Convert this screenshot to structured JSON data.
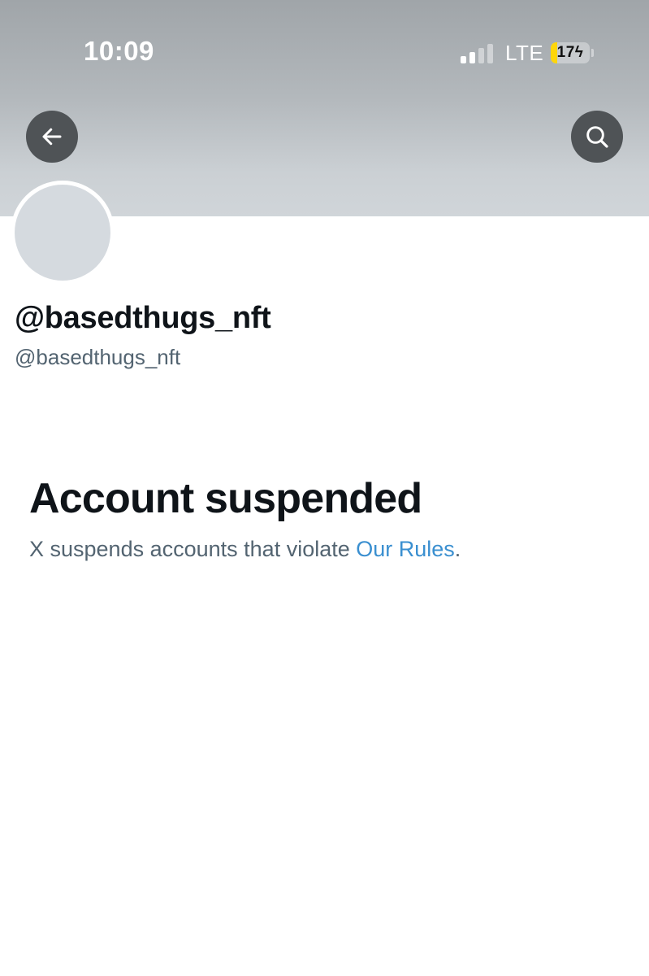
{
  "status_bar": {
    "time": "10:09",
    "network": "LTE",
    "battery_level": "17",
    "battery_fraction": 0.17,
    "signal_bars_active": 2,
    "signal_bars_total": 4
  },
  "header": {
    "back_icon": "arrow-left-icon",
    "search_icon": "search-icon"
  },
  "profile": {
    "display_name": "@basedthugs_nft",
    "handle": "@basedthugs_nft"
  },
  "notice": {
    "title": "Account suspended",
    "description_prefix": "X suspends accounts that violate ",
    "link_text": "Our Rules",
    "description_suffix": "."
  },
  "colors": {
    "text_primary": "#0f1419",
    "text_secondary": "#536471",
    "link": "#3a8fd0",
    "battery_accent": "#ffd60a",
    "button_bg": "#4f5356",
    "avatar_placeholder": "#d5dadf"
  }
}
